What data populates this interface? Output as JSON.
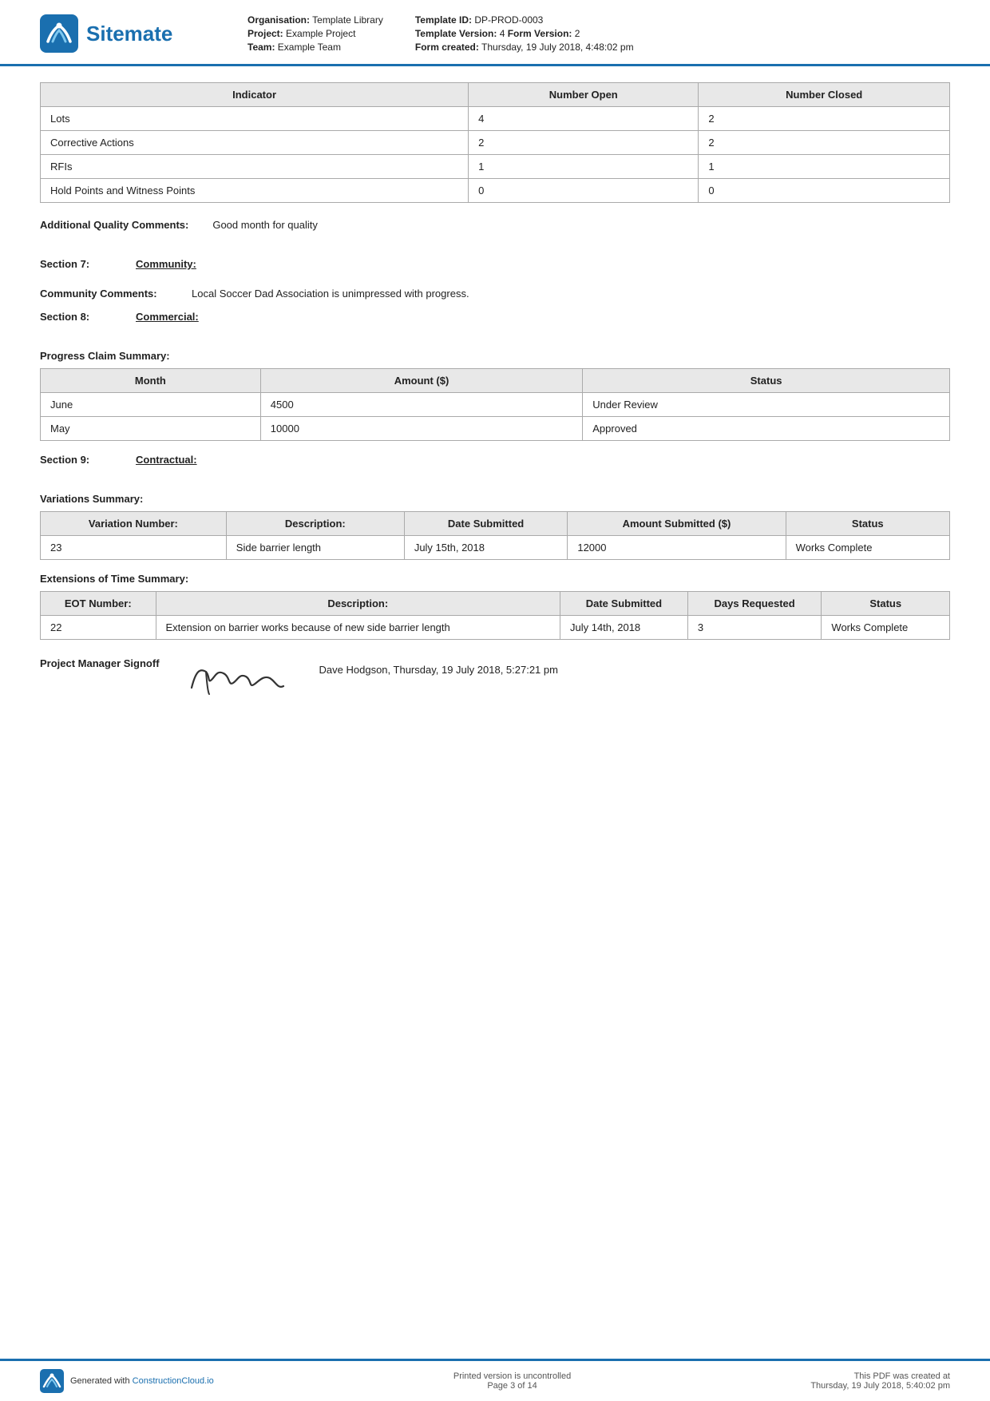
{
  "header": {
    "logo_text": "Sitemate",
    "org_label": "Organisation:",
    "org_value": "Template Library",
    "project_label": "Project:",
    "project_value": "Example Project",
    "team_label": "Team:",
    "team_value": "Example Team",
    "template_id_label": "Template ID:",
    "template_id_value": "DP-PROD-0003",
    "template_version_label": "Template Version:",
    "template_version_value": "4",
    "form_version_label": "Form Version:",
    "form_version_value": "2",
    "form_created_label": "Form created:",
    "form_created_value": "Thursday, 19 July 2018, 4:48:02 pm"
  },
  "indicator_table": {
    "col1": "Indicator",
    "col2": "Number Open",
    "col3": "Number Closed",
    "rows": [
      {
        "indicator": "Lots",
        "open": "4",
        "closed": "2"
      },
      {
        "indicator": "Corrective Actions",
        "open": "2",
        "closed": "2"
      },
      {
        "indicator": "RFIs",
        "open": "1",
        "closed": "1"
      },
      {
        "indicator": "Hold Points and Witness Points",
        "open": "0",
        "closed": "0"
      }
    ]
  },
  "additional_quality": {
    "label": "Additional Quality Comments:",
    "value": "Good month for quality"
  },
  "section7": {
    "num": "Section 7:",
    "title": "Community:"
  },
  "community_comments": {
    "label": "Community Comments:",
    "value": "Local Soccer Dad Association is unimpressed with progress."
  },
  "section8": {
    "num": "Section 8:",
    "title": "Commercial:"
  },
  "progress_claim": {
    "title": "Progress Claim Summary:",
    "col1": "Month",
    "col2": "Amount ($)",
    "col3": "Status",
    "rows": [
      {
        "month": "June",
        "amount": "4500",
        "status": "Under Review"
      },
      {
        "month": "May",
        "amount": "10000",
        "status": "Approved"
      }
    ]
  },
  "section9": {
    "num": "Section 9:",
    "title": "Contractual:"
  },
  "variations_summary": {
    "title": "Variations Summary:",
    "col1": "Variation Number:",
    "col2": "Description:",
    "col3": "Date Submitted",
    "col4": "Amount Submitted ($)",
    "col5": "Status",
    "rows": [
      {
        "number": "23",
        "description": "Side barrier length",
        "date_submitted": "July 15th, 2018",
        "amount": "12000",
        "status": "Works Complete"
      }
    ]
  },
  "eot_summary": {
    "title": "Extensions of Time Summary:",
    "col1": "EOT Number:",
    "col2": "Description:",
    "col3": "Date Submitted",
    "col4": "Days Requested",
    "col5": "Status",
    "rows": [
      {
        "number": "22",
        "description": "Extension on barrier works because of new side barrier length",
        "date_submitted": "July 14th, 2018",
        "days": "3",
        "status": "Works Complete"
      }
    ]
  },
  "project_manager": {
    "label": "Project Manager Signoff",
    "detail": "Dave Hodgson, Thursday, 19 July 2018, 5:27:21 pm"
  },
  "footer": {
    "generated_label": "Generated with ",
    "generated_link": "ConstructionCloud.io",
    "printed": "Printed version is uncontrolled",
    "page": "Page 3 of 14",
    "pdf_created_label": "This PDF was created at",
    "pdf_created_value": "Thursday, 19 July 2018, 5:40:02 pm"
  }
}
